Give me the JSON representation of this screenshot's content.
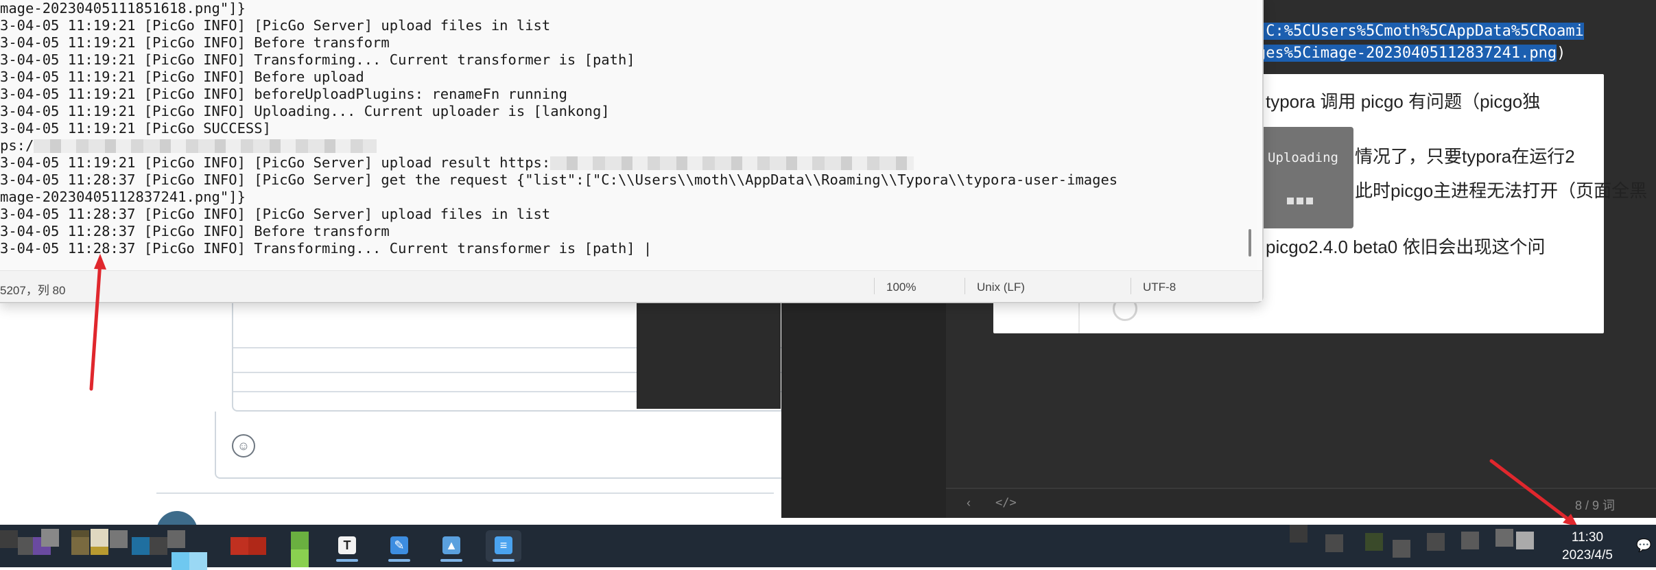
{
  "notepad": {
    "log_lines": [
      "mage-20230405111851618.png\"]}",
      "3-04-05 11:19:21 [PicGo INFO] [PicGo Server] upload files in list",
      "3-04-05 11:19:21 [PicGo INFO] Before transform",
      "3-04-05 11:19:21 [PicGo INFO] Transforming... Current transformer is [path]",
      "3-04-05 11:19:21 [PicGo INFO] Before upload",
      "3-04-05 11:19:21 [PicGo INFO] beforeUploadPlugins: renameFn running",
      "3-04-05 11:19:21 [PicGo INFO] Uploading... Current uploader is [lankong]",
      "3-04-05 11:19:21 [PicGo SUCCESS]",
      "ps:/",
      "3-04-05 11:19:21 [PicGo INFO] [PicGo Server] upload result https:",
      "3-04-05 11:28:37 [PicGo INFO] [PicGo Server] get the request {\"list\":[\"C:\\\\Users\\\\moth\\\\AppData\\\\Roaming\\\\Typora\\\\typora-user-images",
      "mage-20230405112837241.png\"]}",
      "3-04-05 11:28:37 [PicGo INFO] [PicGo Server] upload files in list",
      "3-04-05 11:28:37 [PicGo INFO] Before transform",
      "3-04-05 11:28:37 [PicGo INFO] Transforming... Current transformer is [path] |"
    ],
    "status": {
      "position": "5207，列 80",
      "zoom": "100%",
      "line_ending": "Unix (LF)",
      "encoding": "UTF-8"
    }
  },
  "editor": {
    "selected_line_1": "(C:%5CUsers%5Cmoth%5CAppData%5CRoami",
    "selected_line_2": "ges%5Cimage-20230405112837241.png",
    "selected_line_2_tail": ")",
    "note_lines": [
      "typora 调用 picgo 有问题（picgo独",
      "情况了，只要typora在运行2",
      "此时picgo主进程无法打开（页面全黑",
      "picgo2.4.0 beta0 依旧会出现这个问"
    ],
    "uploading_label": "Uploading",
    "word_count": "8 / 9 词",
    "footer_nav_icon": "chevron-left-icon",
    "footer_code_label": "</>"
  },
  "taskbar": {
    "clock_time": "11:30",
    "clock_date": "2023/4/5",
    "apps": [
      {
        "name": "typora",
        "icon_text": "T",
        "color": "#f2f2f2"
      },
      {
        "name": "paint",
        "icon_text": "✎",
        "color": "#3d8de0"
      },
      {
        "name": "photos",
        "icon_text": "▲",
        "color": "#5aa0de"
      },
      {
        "name": "notepad",
        "icon_text": "≡",
        "color": "#4aa3f0"
      }
    ]
  },
  "colors": {
    "arrow": "#e0272d",
    "selection": "#1c5fb0",
    "taskbar": "#202a36"
  }
}
